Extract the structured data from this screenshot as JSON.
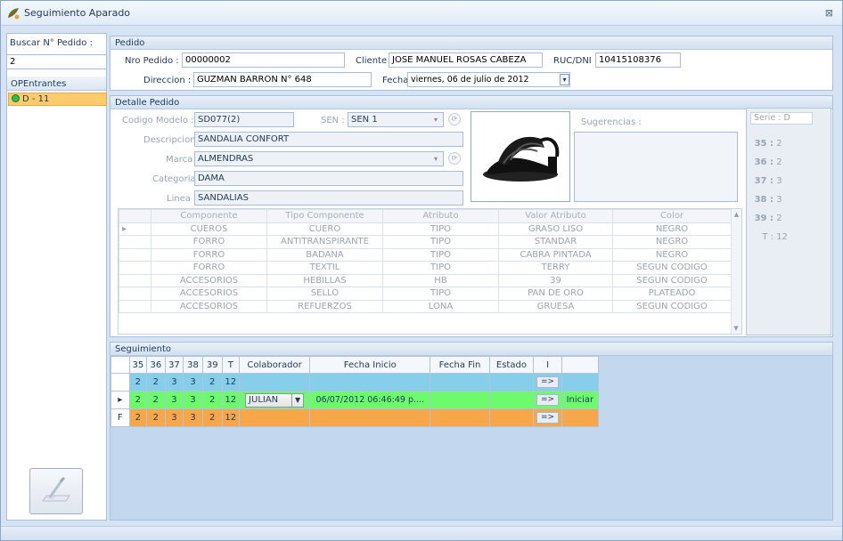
{
  "window": {
    "title": "Seguimiento Aparado",
    "close_glyph": "⊠"
  },
  "left": {
    "buscar_label": "Buscar N° Pedido :",
    "buscar_value": "2",
    "op_header": "OPEntrantes",
    "op_items": [
      {
        "label": "D - 11"
      }
    ]
  },
  "pedido": {
    "header": "Pedido",
    "nro_label": "Nro Pedido :",
    "nro_value": "00000002",
    "cliente_label": "Cliente :",
    "cliente_value": "JOSE MANUEL ROSAS CABEZA",
    "ruc_label": "RUC/DNI :",
    "ruc_value": "10415108376",
    "direccion_label": "Direccion :",
    "direccion_value": "GUZMAN BARRON N° 648",
    "fecha_label": "Fecha :",
    "fecha_value": "viernes, 06 de julio de 2012"
  },
  "detalle": {
    "header": "Detalle Pedido",
    "codigo_label": "Codigo Modelo :",
    "codigo_value": "SD077(2)",
    "sen_label": "SEN :",
    "sen_value": "SEN 1",
    "descripcion_label": "Descripcion :",
    "descripcion_value": "SANDALIA CONFORT",
    "marca_label": "Marca :",
    "marca_value": "ALMENDRAS",
    "categoria_label": "Categoria :",
    "categoria_value": "DAMA",
    "linea_label": "Linea :",
    "linea_value": "SANDALIAS",
    "sugerencias_label": "Sugerencias :",
    "serie_label": "Serie : D",
    "serie": [
      {
        "size": "35 :",
        "qty": "2"
      },
      {
        "size": "36 :",
        "qty": "2"
      },
      {
        "size": "37 :",
        "qty": "3"
      },
      {
        "size": "38 :",
        "qty": "3"
      },
      {
        "size": "39 :",
        "qty": "2"
      },
      {
        "size": "T :",
        "qty": "12"
      }
    ],
    "columns": [
      "Componente",
      "Tipo Componente",
      "Atributo",
      "Valor Atributo",
      "Color"
    ],
    "rows": [
      [
        "CUEROS",
        "CUERO",
        "TIPO",
        "GRASO LISO",
        "NEGRO"
      ],
      [
        "FORRO",
        "ANTITRANSPIRANTE",
        "TIPO",
        "STANDAR",
        "NEGRO"
      ],
      [
        "FORRO",
        "BADANA",
        "TIPO",
        "CABRA PINTADA",
        "NEGRO"
      ],
      [
        "FORRO",
        "TEXTIL",
        "TIPO",
        "TERRY",
        "SEGUN CODIGO"
      ],
      [
        "ACCESORIOS",
        "HEBILLAS",
        "HB",
        "39",
        "SEGUN CODIGO"
      ],
      [
        "ACCESORIOS",
        "SELLO",
        "TIPO",
        "PAN DE ORO",
        "PLATEADO"
      ],
      [
        "ACCESORIOS",
        "REFUERZOS",
        "LONA",
        "GRUESA",
        "SEGUN CODIGO"
      ]
    ]
  },
  "seguimiento": {
    "header": "Seguimiento",
    "columns": [
      "35",
      "36",
      "37",
      "38",
      "39",
      "T",
      "Colaborador",
      "Fecha Inicio",
      "Fecha Fin",
      "Estado",
      "I",
      ""
    ],
    "rows": [
      {
        "marker": "",
        "sizes": [
          "2",
          "2",
          "3",
          "3",
          "2",
          "12"
        ],
        "colaborador": "",
        "inicio": "",
        "fin": "",
        "estado": "",
        "btn": "=>",
        "accion": ""
      },
      {
        "marker": "▸",
        "sizes": [
          "2",
          "2",
          "3",
          "3",
          "2",
          "12"
        ],
        "colaborador": "JULIAN",
        "inicio": "06/07/2012 06:46:49 p....",
        "fin": "",
        "estado": "",
        "btn": "=>",
        "accion": "Iniciar"
      },
      {
        "marker": "F",
        "sizes": [
          "2",
          "2",
          "3",
          "3",
          "2",
          "12"
        ],
        "colaborador": "",
        "inicio": "",
        "fin": "",
        "estado": "",
        "btn": "=>",
        "accion": ""
      }
    ]
  },
  "colors": {
    "blue_row": "#87ceeb",
    "green_row": "#6dfa6d",
    "orange_row": "#f7a64a",
    "selected_op": "#fccc6c"
  }
}
